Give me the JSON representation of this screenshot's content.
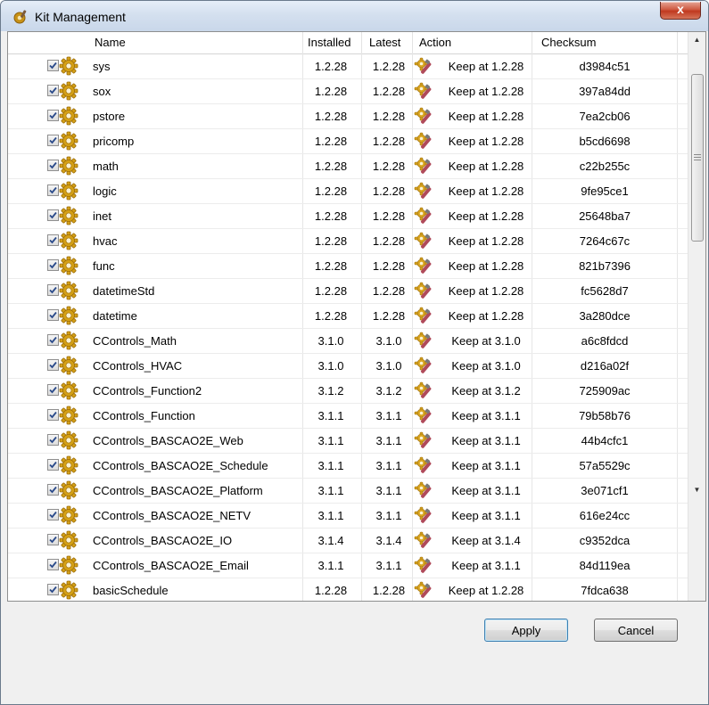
{
  "window": {
    "title": "Kit Management",
    "close_glyph": "x"
  },
  "table": {
    "columns": [
      "Name",
      "Installed",
      "Latest",
      "Action",
      "Checksum"
    ],
    "rows": [
      {
        "checked": true,
        "name": "sys",
        "installed": "1.2.28",
        "latest": "1.2.28",
        "action": "Keep at 1.2.28",
        "checksum": "d3984c51"
      },
      {
        "checked": true,
        "name": "sox",
        "installed": "1.2.28",
        "latest": "1.2.28",
        "action": "Keep at 1.2.28",
        "checksum": "397a84dd"
      },
      {
        "checked": true,
        "name": "pstore",
        "installed": "1.2.28",
        "latest": "1.2.28",
        "action": "Keep at 1.2.28",
        "checksum": "7ea2cb06"
      },
      {
        "checked": true,
        "name": "pricomp",
        "installed": "1.2.28",
        "latest": "1.2.28",
        "action": "Keep at 1.2.28",
        "checksum": "b5cd6698"
      },
      {
        "checked": true,
        "name": "math",
        "installed": "1.2.28",
        "latest": "1.2.28",
        "action": "Keep at 1.2.28",
        "checksum": "c22b255c"
      },
      {
        "checked": true,
        "name": "logic",
        "installed": "1.2.28",
        "latest": "1.2.28",
        "action": "Keep at 1.2.28",
        "checksum": "9fe95ce1"
      },
      {
        "checked": true,
        "name": "inet",
        "installed": "1.2.28",
        "latest": "1.2.28",
        "action": "Keep at 1.2.28",
        "checksum": "25648ba7"
      },
      {
        "checked": true,
        "name": "hvac",
        "installed": "1.2.28",
        "latest": "1.2.28",
        "action": "Keep at 1.2.28",
        "checksum": "7264c67c"
      },
      {
        "checked": true,
        "name": "func",
        "installed": "1.2.28",
        "latest": "1.2.28",
        "action": "Keep at 1.2.28",
        "checksum": "821b7396"
      },
      {
        "checked": true,
        "name": "datetimeStd",
        "installed": "1.2.28",
        "latest": "1.2.28",
        "action": "Keep at 1.2.28",
        "checksum": "fc5628d7"
      },
      {
        "checked": true,
        "name": "datetime",
        "installed": "1.2.28",
        "latest": "1.2.28",
        "action": "Keep at 1.2.28",
        "checksum": "3a280dce"
      },
      {
        "checked": true,
        "name": "CControls_Math",
        "installed": "3.1.0",
        "latest": "3.1.0",
        "action": "Keep at 3.1.0",
        "checksum": "a6c8fdcd"
      },
      {
        "checked": true,
        "name": "CControls_HVAC",
        "installed": "3.1.0",
        "latest": "3.1.0",
        "action": "Keep at 3.1.0",
        "checksum": "d216a02f"
      },
      {
        "checked": true,
        "name": "CControls_Function2",
        "installed": "3.1.2",
        "latest": "3.1.2",
        "action": "Keep at 3.1.2",
        "checksum": "725909ac"
      },
      {
        "checked": true,
        "name": "CControls_Function",
        "installed": "3.1.1",
        "latest": "3.1.1",
        "action": "Keep at 3.1.1",
        "checksum": "79b58b76"
      },
      {
        "checked": true,
        "name": "CControls_BASCAO2E_Web",
        "installed": "3.1.1",
        "latest": "3.1.1",
        "action": "Keep at 3.1.1",
        "checksum": "44b4cfc1"
      },
      {
        "checked": true,
        "name": "CControls_BASCAO2E_Schedule",
        "installed": "3.1.1",
        "latest": "3.1.1",
        "action": "Keep at 3.1.1",
        "checksum": "57a5529c"
      },
      {
        "checked": true,
        "name": "CControls_BASCAO2E_Platform",
        "installed": "3.1.1",
        "latest": "3.1.1",
        "action": "Keep at 3.1.1",
        "checksum": "3e071cf1"
      },
      {
        "checked": true,
        "name": "CControls_BASCAO2E_NETV",
        "installed": "3.1.1",
        "latest": "3.1.1",
        "action": "Keep at 3.1.1",
        "checksum": "616e24cc"
      },
      {
        "checked": true,
        "name": "CControls_BASCAO2E_IO",
        "installed": "3.1.4",
        "latest": "3.1.4",
        "action": "Keep at 3.1.4",
        "checksum": "c9352dca"
      },
      {
        "checked": true,
        "name": "CControls_BASCAO2E_Email",
        "installed": "3.1.1",
        "latest": "3.1.1",
        "action": "Keep at 3.1.1",
        "checksum": "84d119ea"
      },
      {
        "checked": true,
        "name": "basicSchedule",
        "installed": "1.2.28",
        "latest": "1.2.28",
        "action": "Keep at 1.2.28",
        "checksum": "7fdca638"
      }
    ]
  },
  "buttons": {
    "apply": "Apply",
    "cancel": "Cancel"
  },
  "icons": {
    "title": "kit-gear-icon",
    "row_kit": "gear-icon",
    "row_action": "keep-wrench-icon",
    "checkbox": "checkmark-icon"
  },
  "colors": {
    "gear": "#d4a017",
    "gear_dark": "#9a6b08",
    "check": "#2a4a8a"
  }
}
